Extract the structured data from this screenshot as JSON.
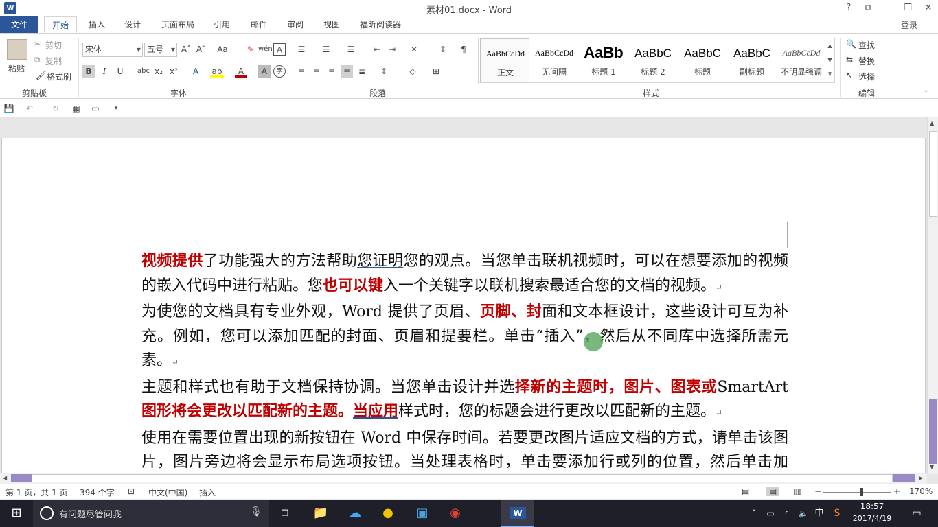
{
  "window": {
    "title": "素材01.docx - Word",
    "help": "?",
    "restore": "⧉",
    "minimize": "—",
    "maximize": "❐",
    "close": "✕"
  },
  "tabs": {
    "file": "文件",
    "items": [
      "开始",
      "插入",
      "设计",
      "页面布局",
      "引用",
      "邮件",
      "审阅",
      "视图",
      "福昕阅读器"
    ],
    "active": "开始",
    "login": "登录"
  },
  "clipboard": {
    "paste": "粘贴",
    "cut": "剪切",
    "copy": "复制",
    "format_painter": "格式刷",
    "label": "剪贴板"
  },
  "font": {
    "name": "宋体",
    "size": "五号",
    "grow": "A˄",
    "shrink": "A˅",
    "case": "Aa",
    "label": "字体",
    "bold": "B",
    "italic": "I",
    "underline": "U",
    "strike": "abc",
    "sub": "x₂",
    "sup": "x²",
    "text_effect": "A",
    "highlight": "ab",
    "font_color": "A",
    "char_shading": "A",
    "enclose": "字",
    "phonetic": "wén",
    "border_char": "A"
  },
  "paragraph": {
    "label": "段落"
  },
  "styles": {
    "label": "样式",
    "items": [
      {
        "preview": "AaBbCcDd",
        "name": "正文"
      },
      {
        "preview": "AaBbCcDd",
        "name": "无间隔"
      },
      {
        "preview": "AaBb",
        "name": "标题 1"
      },
      {
        "preview": "AaBbC",
        "name": "标题 2"
      },
      {
        "preview": "AaBbC",
        "name": "标题"
      },
      {
        "preview": "AaBbC",
        "name": "副标题"
      },
      {
        "preview": "AaBbCcDd",
        "name": "不明显强调"
      }
    ]
  },
  "editing": {
    "find": "查找",
    "replace": "替换",
    "select": "选择",
    "label": "编辑"
  },
  "document": {
    "p1": [
      {
        "t": "视频提供",
        "s": "hl"
      },
      {
        "t": "了功能强大的方法帮助",
        "s": ""
      },
      {
        "t": "您证明",
        "s": "ul"
      },
      {
        "t": "您的观点。当您单击联机视频时，可以在想要添加的视频的嵌入代码中进行粘贴。您",
        "s": ""
      },
      {
        "t": "也可以键",
        "s": "hl"
      },
      {
        "t": "入一个关键字以联机搜索最适合您的文档的视频。",
        "s": ""
      }
    ],
    "p2": [
      {
        "t": "为使您的文档具有专业外观，Word 提供了页眉、",
        "s": ""
      },
      {
        "t": "页脚、封",
        "s": "hl"
      },
      {
        "t": "面和文本框设计，这些设计可互为补充。例如，您可以添加匹配的封面、页眉和提要栏。单击“插入”，然后从不同库中选择所需元素。",
        "s": ""
      }
    ],
    "p3": [
      {
        "t": "主题和样式也有助于文档保持协调。当您单击设计并选",
        "s": ""
      },
      {
        "t": "择新的主题时，图片、图表或",
        "s": "hl"
      },
      {
        "t": "SmartArt ",
        "s": ""
      },
      {
        "t": "图形将会更改以匹配新的主题。",
        "s": "hl"
      },
      {
        "t": "当应用",
        "s": "hl ul"
      },
      {
        "t": "样式时，您的标题会进行更改以匹配新的主题。",
        "s": ""
      }
    ],
    "p4": [
      {
        "t": "使用在需要位置出现的新按钮在 Word 中保存时间。若要更改图片适应文档的方式，请单击该图片，图片旁边将会显示布局选项按钮。当处理表格时，单击要添加行或列的位置，然后单击加号。",
        "s": ""
      }
    ]
  },
  "status": {
    "page": "第 1 页，共 1 页",
    "words": "394 个字",
    "lang": "中文(中国)",
    "mode": "插入",
    "zoom": "170%",
    "zoom_minus": "−",
    "zoom_plus": "+"
  },
  "taskbar": {
    "search": "有问题尽管问我",
    "time": "18:57",
    "date": "2017/4/19",
    "ime": "中"
  }
}
